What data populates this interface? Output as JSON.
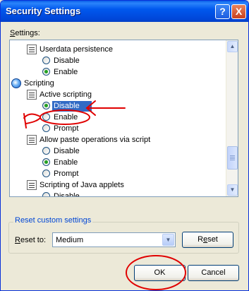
{
  "window": {
    "title": "Security Settings",
    "help_button": "?",
    "close_button": "X"
  },
  "settings": {
    "label_prefix": "",
    "label_access": "S",
    "label_rest": "ettings:",
    "items": [
      {
        "kind": "setting",
        "icon": "script-icon",
        "label": "Userdata persistence"
      },
      {
        "kind": "option",
        "label": "Disable",
        "checked": false
      },
      {
        "kind": "option",
        "label": "Enable",
        "checked": true
      },
      {
        "kind": "category",
        "icon": "globe-icon",
        "label": "Scripting"
      },
      {
        "kind": "setting",
        "icon": "script-icon",
        "label": "Active scripting"
      },
      {
        "kind": "option",
        "label": "Disable",
        "checked": true,
        "selected": true
      },
      {
        "kind": "option",
        "label": "Enable",
        "checked": false
      },
      {
        "kind": "option",
        "label": "Prompt",
        "checked": false
      },
      {
        "kind": "setting",
        "icon": "script-icon",
        "label": "Allow paste operations via script"
      },
      {
        "kind": "option",
        "label": "Disable",
        "checked": false
      },
      {
        "kind": "option",
        "label": "Enable",
        "checked": true
      },
      {
        "kind": "option",
        "label": "Prompt",
        "checked": false
      },
      {
        "kind": "setting",
        "icon": "script-icon",
        "label": "Scripting of Java applets"
      },
      {
        "kind": "option",
        "label": "Disable",
        "checked": false
      }
    ]
  },
  "reset": {
    "group_label": "Reset custom settings",
    "reset_to_access": "R",
    "reset_to_rest": "eset to:",
    "selected_level": "Medium",
    "reset_button_pre": "R",
    "reset_button_access": "e",
    "reset_button_rest": "set"
  },
  "buttons": {
    "ok": "OK",
    "cancel": "Cancel"
  },
  "annotation_color": "#e00000"
}
